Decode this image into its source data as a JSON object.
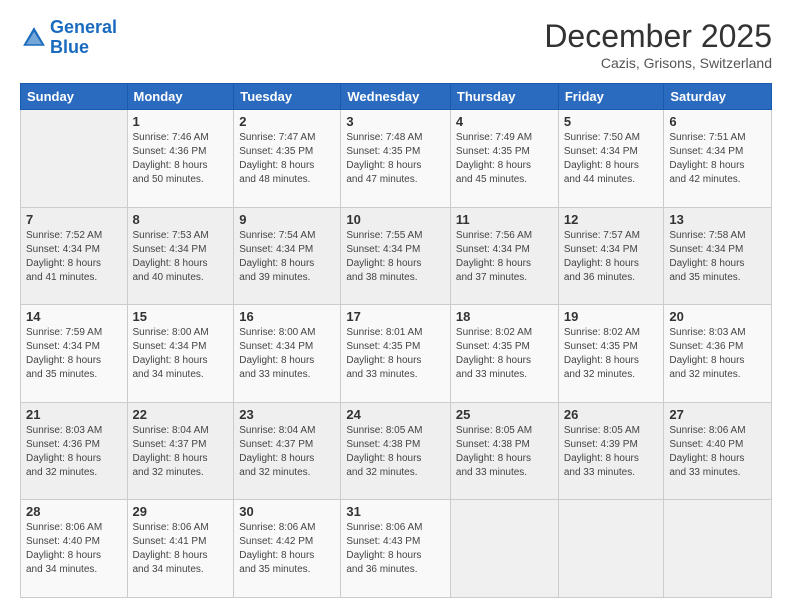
{
  "logo": {
    "line1": "General",
    "line2": "Blue"
  },
  "header": {
    "month": "December 2025",
    "location": "Cazis, Grisons, Switzerland"
  },
  "weekdays": [
    "Sunday",
    "Monday",
    "Tuesday",
    "Wednesday",
    "Thursday",
    "Friday",
    "Saturday"
  ],
  "weeks": [
    [
      {
        "day": "",
        "info": ""
      },
      {
        "day": "1",
        "info": "Sunrise: 7:46 AM\nSunset: 4:36 PM\nDaylight: 8 hours\nand 50 minutes."
      },
      {
        "day": "2",
        "info": "Sunrise: 7:47 AM\nSunset: 4:35 PM\nDaylight: 8 hours\nand 48 minutes."
      },
      {
        "day": "3",
        "info": "Sunrise: 7:48 AM\nSunset: 4:35 PM\nDaylight: 8 hours\nand 47 minutes."
      },
      {
        "day": "4",
        "info": "Sunrise: 7:49 AM\nSunset: 4:35 PM\nDaylight: 8 hours\nand 45 minutes."
      },
      {
        "day": "5",
        "info": "Sunrise: 7:50 AM\nSunset: 4:34 PM\nDaylight: 8 hours\nand 44 minutes."
      },
      {
        "day": "6",
        "info": "Sunrise: 7:51 AM\nSunset: 4:34 PM\nDaylight: 8 hours\nand 42 minutes."
      }
    ],
    [
      {
        "day": "7",
        "info": "Sunrise: 7:52 AM\nSunset: 4:34 PM\nDaylight: 8 hours\nand 41 minutes."
      },
      {
        "day": "8",
        "info": "Sunrise: 7:53 AM\nSunset: 4:34 PM\nDaylight: 8 hours\nand 40 minutes."
      },
      {
        "day": "9",
        "info": "Sunrise: 7:54 AM\nSunset: 4:34 PM\nDaylight: 8 hours\nand 39 minutes."
      },
      {
        "day": "10",
        "info": "Sunrise: 7:55 AM\nSunset: 4:34 PM\nDaylight: 8 hours\nand 38 minutes."
      },
      {
        "day": "11",
        "info": "Sunrise: 7:56 AM\nSunset: 4:34 PM\nDaylight: 8 hours\nand 37 minutes."
      },
      {
        "day": "12",
        "info": "Sunrise: 7:57 AM\nSunset: 4:34 PM\nDaylight: 8 hours\nand 36 minutes."
      },
      {
        "day": "13",
        "info": "Sunrise: 7:58 AM\nSunset: 4:34 PM\nDaylight: 8 hours\nand 35 minutes."
      }
    ],
    [
      {
        "day": "14",
        "info": "Sunrise: 7:59 AM\nSunset: 4:34 PM\nDaylight: 8 hours\nand 35 minutes."
      },
      {
        "day": "15",
        "info": "Sunrise: 8:00 AM\nSunset: 4:34 PM\nDaylight: 8 hours\nand 34 minutes."
      },
      {
        "day": "16",
        "info": "Sunrise: 8:00 AM\nSunset: 4:34 PM\nDaylight: 8 hours\nand 33 minutes."
      },
      {
        "day": "17",
        "info": "Sunrise: 8:01 AM\nSunset: 4:35 PM\nDaylight: 8 hours\nand 33 minutes."
      },
      {
        "day": "18",
        "info": "Sunrise: 8:02 AM\nSunset: 4:35 PM\nDaylight: 8 hours\nand 33 minutes."
      },
      {
        "day": "19",
        "info": "Sunrise: 8:02 AM\nSunset: 4:35 PM\nDaylight: 8 hours\nand 32 minutes."
      },
      {
        "day": "20",
        "info": "Sunrise: 8:03 AM\nSunset: 4:36 PM\nDaylight: 8 hours\nand 32 minutes."
      }
    ],
    [
      {
        "day": "21",
        "info": "Sunrise: 8:03 AM\nSunset: 4:36 PM\nDaylight: 8 hours\nand 32 minutes."
      },
      {
        "day": "22",
        "info": "Sunrise: 8:04 AM\nSunset: 4:37 PM\nDaylight: 8 hours\nand 32 minutes."
      },
      {
        "day": "23",
        "info": "Sunrise: 8:04 AM\nSunset: 4:37 PM\nDaylight: 8 hours\nand 32 minutes."
      },
      {
        "day": "24",
        "info": "Sunrise: 8:05 AM\nSunset: 4:38 PM\nDaylight: 8 hours\nand 32 minutes."
      },
      {
        "day": "25",
        "info": "Sunrise: 8:05 AM\nSunset: 4:38 PM\nDaylight: 8 hours\nand 33 minutes."
      },
      {
        "day": "26",
        "info": "Sunrise: 8:05 AM\nSunset: 4:39 PM\nDaylight: 8 hours\nand 33 minutes."
      },
      {
        "day": "27",
        "info": "Sunrise: 8:06 AM\nSunset: 4:40 PM\nDaylight: 8 hours\nand 33 minutes."
      }
    ],
    [
      {
        "day": "28",
        "info": "Sunrise: 8:06 AM\nSunset: 4:40 PM\nDaylight: 8 hours\nand 34 minutes."
      },
      {
        "day": "29",
        "info": "Sunrise: 8:06 AM\nSunset: 4:41 PM\nDaylight: 8 hours\nand 34 minutes."
      },
      {
        "day": "30",
        "info": "Sunrise: 8:06 AM\nSunset: 4:42 PM\nDaylight: 8 hours\nand 35 minutes."
      },
      {
        "day": "31",
        "info": "Sunrise: 8:06 AM\nSunset: 4:43 PM\nDaylight: 8 hours\nand 36 minutes."
      },
      {
        "day": "",
        "info": ""
      },
      {
        "day": "",
        "info": ""
      },
      {
        "day": "",
        "info": ""
      }
    ]
  ]
}
